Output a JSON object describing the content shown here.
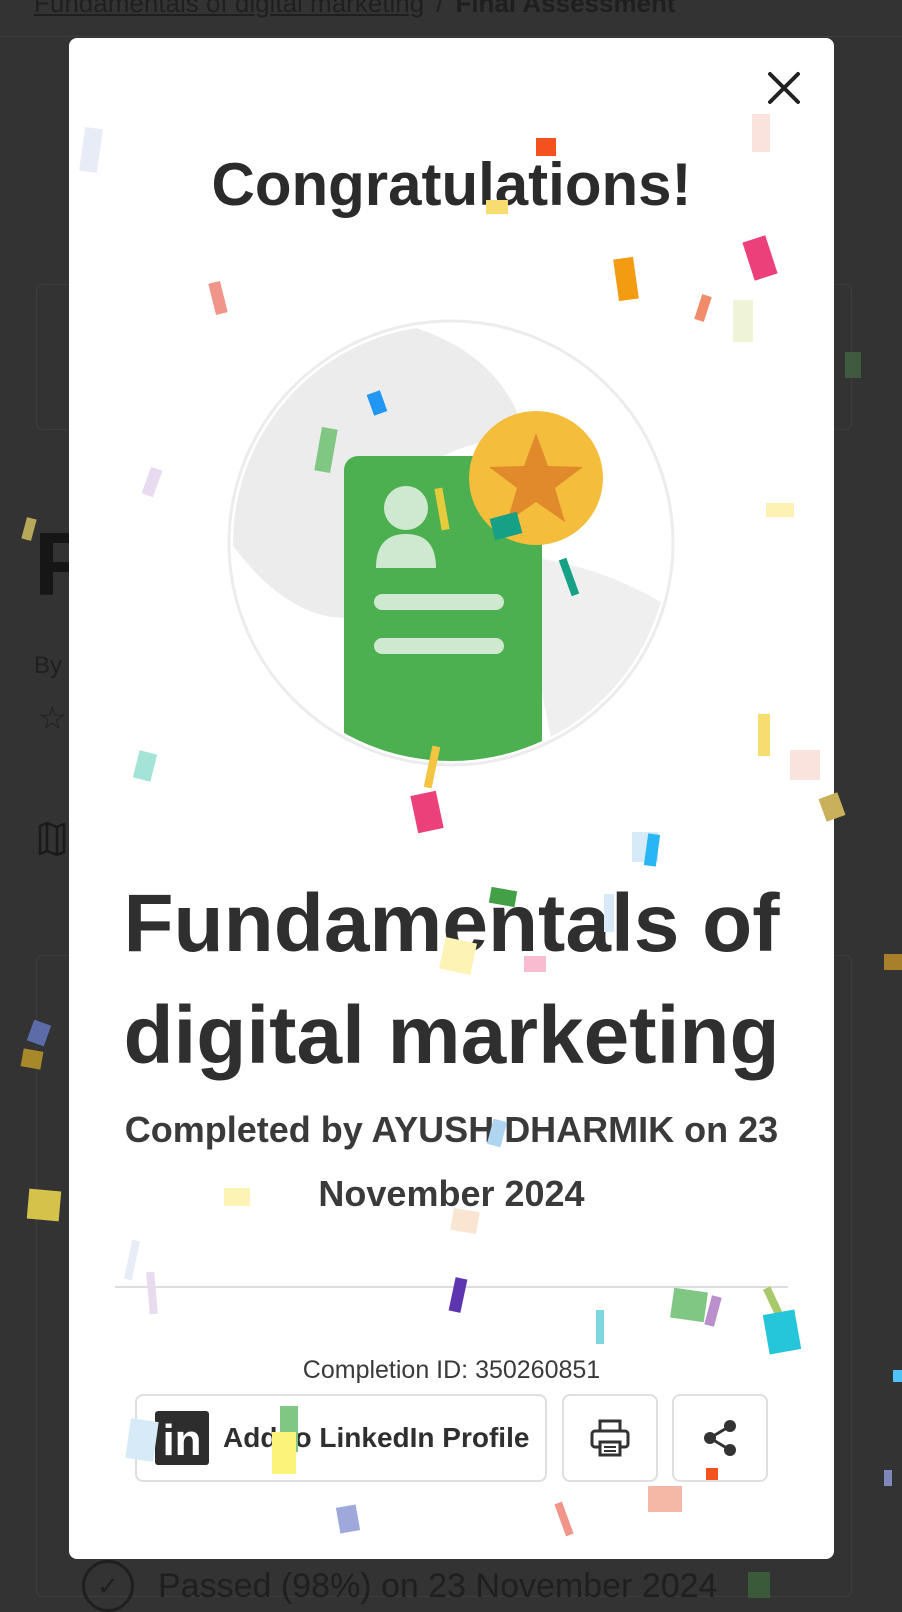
{
  "background_page": {
    "breadcrumb": {
      "course_link": "Fundamentals of digital marketing",
      "separator": "/",
      "current": "Final Assessment"
    },
    "heading_letter": "F",
    "by_label": "By",
    "status_text": "Passed (98%) on 23 November 2024",
    "star_icon": "star-outline-icon",
    "map_icon": "map-icon"
  },
  "modal": {
    "title": "Congratulations!",
    "badge_icon": "certificate-badge-icon",
    "course_title": "Fundamentals of digital marketing",
    "completed_text": "Completed by AYUSH DHARMIK on 23 November 2024",
    "completion_id": "Completion ID: 350260851",
    "buttons": {
      "linkedin_label": "Add to LinkedIn Profile",
      "linkedin_logo": "in",
      "print_icon": "print-icon",
      "share_icon": "share-icon",
      "close_icon": "close-icon"
    }
  },
  "colors": {
    "overlay": "#333333",
    "modal_bg": "#ffffff",
    "badge_green": "#4caf50",
    "badge_star": "#f4bd3b",
    "star_inner": "#e08a2c"
  }
}
